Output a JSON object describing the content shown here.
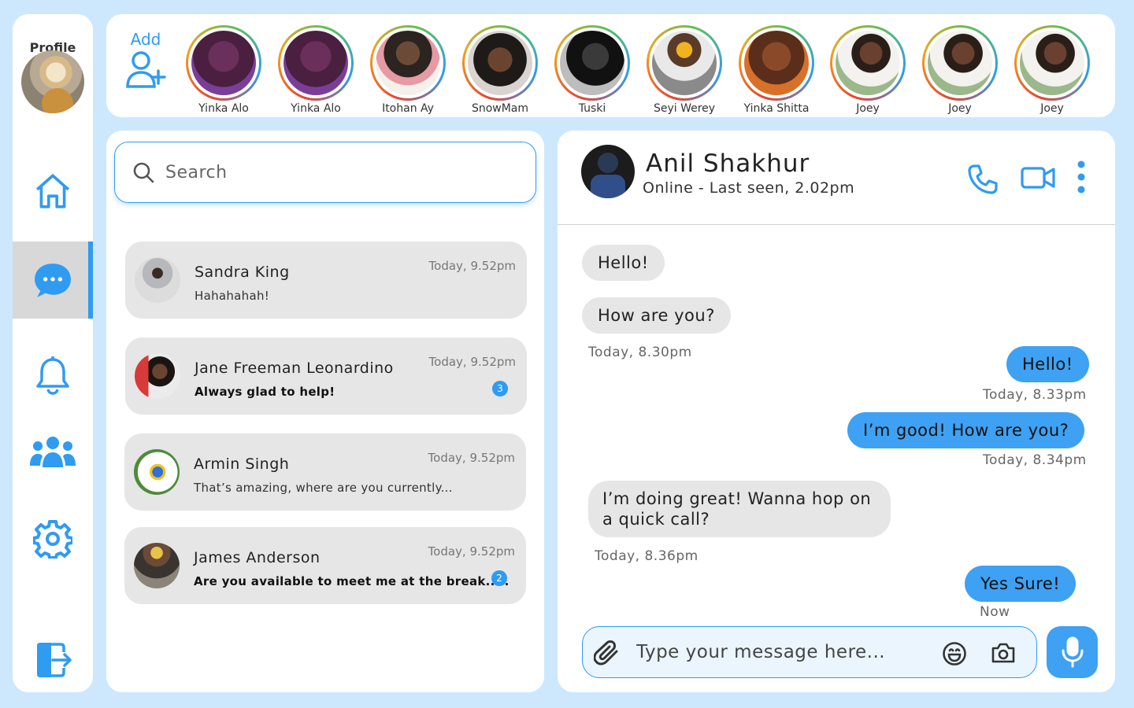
{
  "sidebar": {
    "profile_label": "Profile",
    "items": [
      {
        "name": "home",
        "icon": "home-icon"
      },
      {
        "name": "messages",
        "icon": "chat-bubble-icon",
        "active": true
      },
      {
        "name": "notifications",
        "icon": "bell-icon"
      },
      {
        "name": "groups",
        "icon": "users-icon"
      },
      {
        "name": "settings",
        "icon": "gear-icon"
      },
      {
        "name": "logout",
        "icon": "logout-icon"
      }
    ]
  },
  "stories": {
    "add_label": "Add",
    "items": [
      {
        "name": "Yinka Alo"
      },
      {
        "name": "Yinka Alo"
      },
      {
        "name": "Itohan Ay"
      },
      {
        "name": "SnowMam"
      },
      {
        "name": "Tuski"
      },
      {
        "name": "Seyi Werey"
      },
      {
        "name": "Yinka Shitta"
      },
      {
        "name": "Joey"
      },
      {
        "name": "Joey"
      },
      {
        "name": "Joey"
      }
    ]
  },
  "search": {
    "placeholder": "Search"
  },
  "conversations": [
    {
      "name": "Sandra King",
      "message": "Hahahahah!",
      "time": "Today, 9.52pm",
      "unread": ""
    },
    {
      "name": "Jane Freeman Leonardino",
      "message": "Always glad to help!",
      "time": "Today, 9.52pm",
      "unread": "3"
    },
    {
      "name": "Armin Singh",
      "message": "That’s amazing, where are you currently...",
      "time": "Today, 9.52pm",
      "unread": ""
    },
    {
      "name": "James Anderson",
      "message": "Are you available to meet me at the break.....",
      "time": "Today, 9.52pm",
      "unread": "2"
    }
  ],
  "chat": {
    "contact_name": "Anil Shakhur",
    "status": "Online - Last seen, 2.02pm",
    "messages": [
      {
        "direction": "in",
        "text": "Hello!"
      },
      {
        "direction": "in",
        "text": "How are you?"
      },
      {
        "direction": "out",
        "text": "Hello!"
      },
      {
        "direction": "out",
        "text": "I’m good! How are you?"
      },
      {
        "direction": "in",
        "text": "I’m doing great! Wanna hop on a quick call?"
      },
      {
        "direction": "out",
        "text": "Yes Sure!"
      }
    ],
    "timestamps": [
      "Today, 8.30pm",
      "Today, 8.33pm",
      "Today, 8.34pm",
      "Today, 8.36pm",
      "Now"
    ],
    "composer_placeholder": "Type your message here..."
  },
  "colors": {
    "accent": "#2f9bf1",
    "background": "#cde8fd",
    "incoming_bubble": "#e6e6e6",
    "outgoing_bubble": "#3ea1f3"
  }
}
